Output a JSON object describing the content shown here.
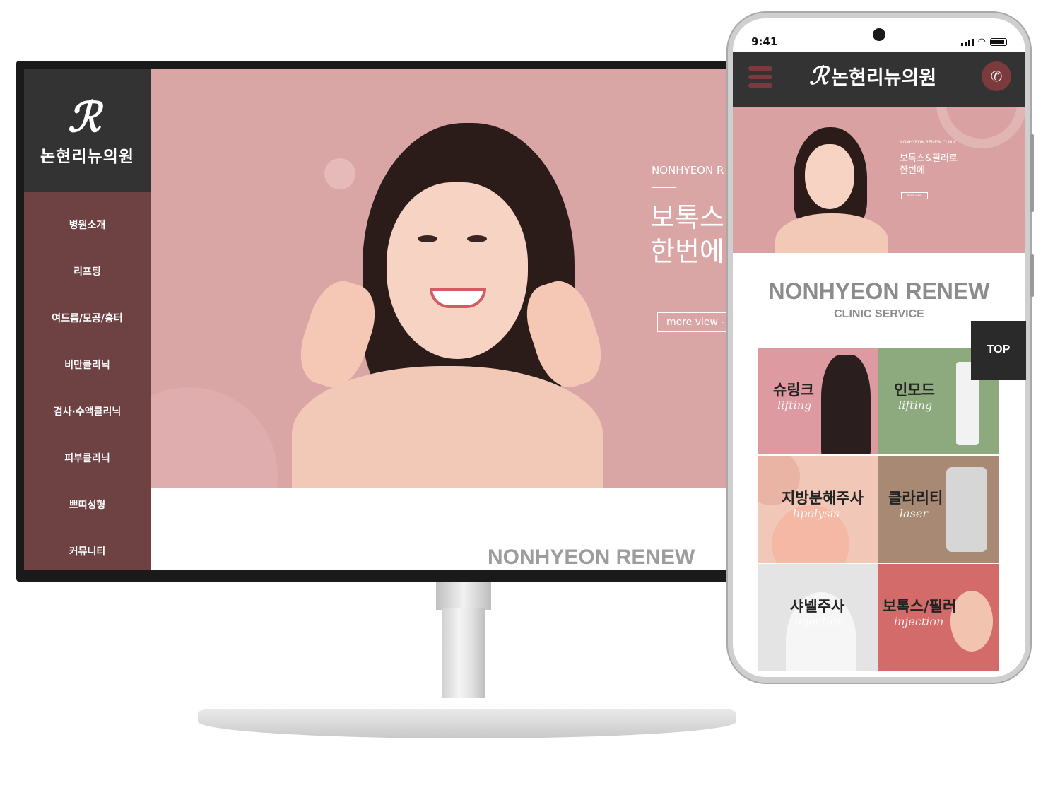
{
  "desktop": {
    "logo_mark": "2",
    "logo_text": "논현리뉴의원",
    "nav": [
      {
        "label": "병원소개"
      },
      {
        "label": "리프팅"
      },
      {
        "label": "여드름/모공/흉터"
      },
      {
        "label": "비만클리닉"
      },
      {
        "label": "검사·수액클리닉"
      },
      {
        "label": "피부클리닉"
      },
      {
        "label": "쁘띠성형"
      },
      {
        "label": "커뮤니티"
      }
    ],
    "hero": {
      "subtitle": "NONHYEON R",
      "title": "보톡스\n한번에",
      "button": "more view -"
    },
    "section_title": "NONHYEON RENEW"
  },
  "mobile": {
    "status_time": "9:41",
    "logo_text": "논현리뉴의원",
    "phone_icon": "phone-icon",
    "hero": {
      "tag": "NONHYEON RENEW CLINIC",
      "title": "보톡스&필러로\n한번에"
    },
    "brand_title": "NONHYEON RENEW",
    "brand_subtitle": "CLINIC SERVICE",
    "top_button": "TOP",
    "tiles": [
      {
        "title": "슈링크",
        "sub": "lifting",
        "color": "#dd9aa0"
      },
      {
        "title": "인모드",
        "sub": "lifting",
        "color": "#8daa7e"
      },
      {
        "title": "지방분해주사",
        "sub": "lipolysis",
        "color": "#f1c8b8"
      },
      {
        "title": "클라리티",
        "sub": "laser",
        "color": "#a88a74"
      },
      {
        "title": "샤넬주사",
        "sub": "injection",
        "color": "#e4e4e4"
      },
      {
        "title": "보톡스/필러",
        "sub": "injection",
        "color": "#d26b69"
      }
    ]
  },
  "colors": {
    "sidebar": "#6e4142",
    "logo_bg": "#333333",
    "hero_bg": "#d9a5a5",
    "accent": "#7b3b3d"
  }
}
